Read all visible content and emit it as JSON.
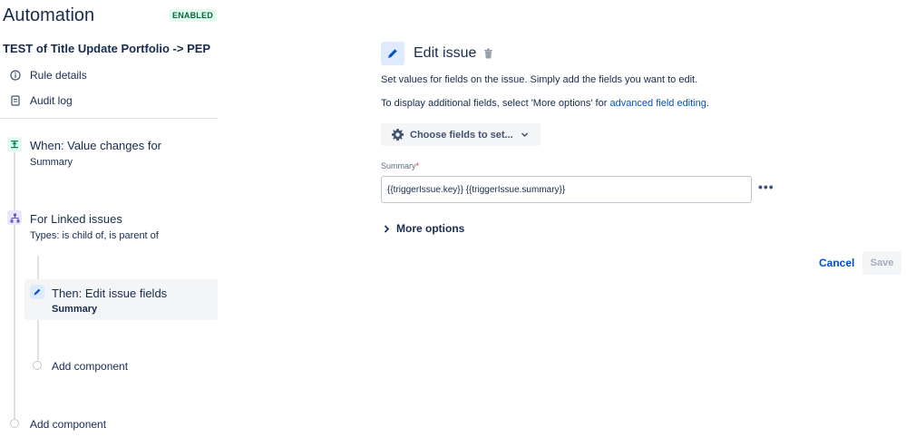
{
  "header": {
    "title": "Automation",
    "status_badge": "ENABLED"
  },
  "rule": {
    "name": "TEST of Title Update Portfolio -> PEP"
  },
  "sidebar": {
    "links": [
      {
        "label": "Rule details",
        "icon": "info-icon"
      },
      {
        "label": "Audit log",
        "icon": "document-icon"
      }
    ]
  },
  "flow": {
    "trigger": {
      "title": "When: Value changes for",
      "subtitle": "Summary",
      "color": "#00875a"
    },
    "branch": {
      "title": "For Linked issues",
      "subtitle": "Types: is child of, is parent of",
      "color": "#6554c0"
    },
    "action": {
      "title": "Then: Edit issue fields",
      "subtitle": "Summary",
      "color": "#0052cc"
    },
    "add_component_inner": "Add component",
    "add_component_outer": "Add component"
  },
  "panel": {
    "title": "Edit issue",
    "description_1": "Set values for fields on the issue. Simply add the fields you want to edit.",
    "description_2_prefix": "To display additional fields, select 'More options' for ",
    "description_2_link": "advanced field editing",
    "description_2_suffix": ".",
    "choose_fields_label": "Choose fields to set...",
    "field": {
      "label": "Summary",
      "required_mark": "*",
      "value": "{{triggerIssue.key}} {{triggerIssue.summary}}"
    },
    "more_dots": "•••",
    "more_options_label": "More options",
    "cancel_label": "Cancel",
    "save_label": "Save"
  }
}
